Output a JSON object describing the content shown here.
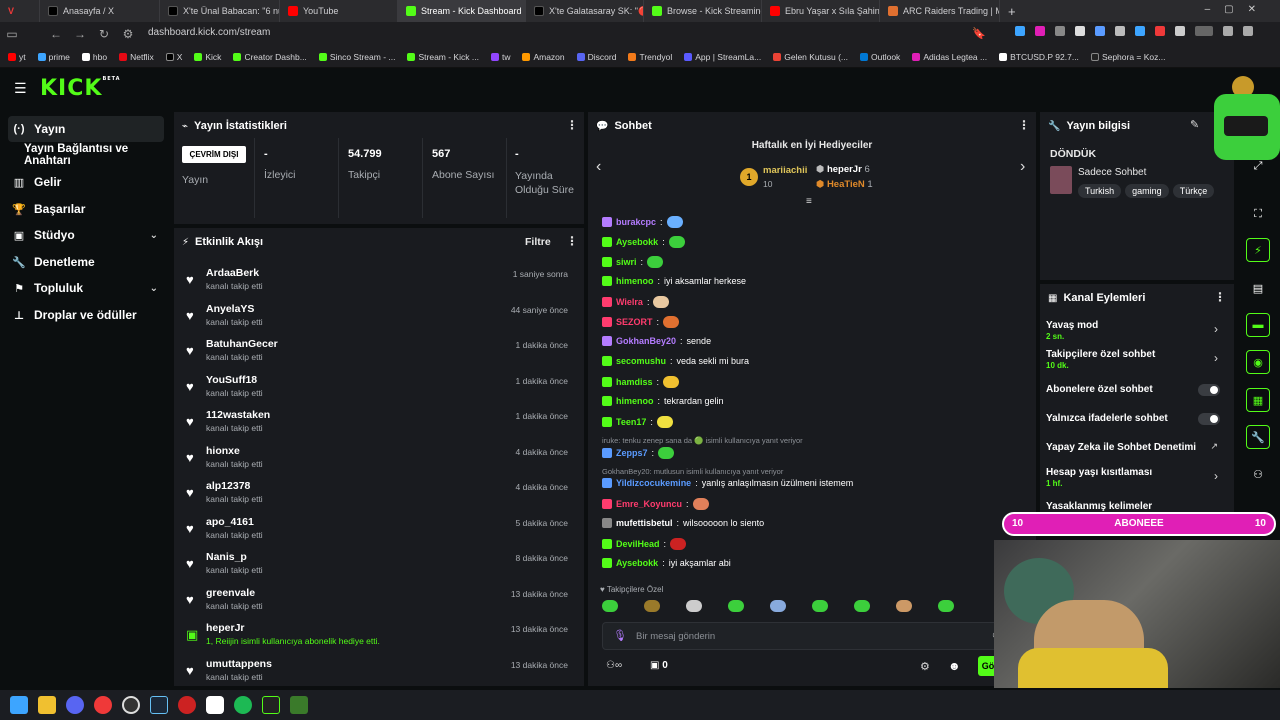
{
  "browser": {
    "tabs": [
      {
        "label": "Anasayfa / X",
        "color": "#000000"
      },
      {
        "label": "X'te Ünal Babacan: \"6 num",
        "color": "#000000"
      },
      {
        "label": "YouTube",
        "color": "#ff0000"
      },
      {
        "label": "Stream - Kick Dashboard",
        "color": "#53fc18"
      },
      {
        "label": "X'te Galatasaray SK: \"🔴 Ju",
        "color": "#000000"
      },
      {
        "label": "Browse - Kick Streaming",
        "color": "#53fc18"
      },
      {
        "label": "Ebru Yaşar x Sıla Şahin x Sa",
        "color": "#ff0000"
      },
      {
        "label": "ARC Raiders Trading | Meta",
        "color": "#e07030"
      }
    ],
    "new_tab": "+",
    "url": "dashboard.kick.com/stream",
    "bookmarks": [
      "yt",
      "prime",
      "hbo",
      "Netflix",
      "X",
      "Kick",
      "Creator Dashb...",
      "Sinco Stream - ...",
      "Stream - Kick ...",
      "tw",
      "Amazon",
      "Discord",
      "Trendyol",
      "App | StreamLa...",
      "Gelen Kutusu (...",
      "Outlook",
      "Adidas Legtea ...",
      "BTCUSD.P 92.7...",
      "Sephora = Koz..."
    ]
  },
  "header": {
    "logo": "KICK",
    "beta": "BETA"
  },
  "sidebar": {
    "items": [
      {
        "label": "Yayın",
        "icon": "broadcast-icon"
      },
      {
        "label": "Yayın Bağlantısı ve Anahtarı"
      },
      {
        "label": "Gelir",
        "icon": "chart-icon"
      },
      {
        "label": "Başarılar",
        "icon": "trophy-icon"
      },
      {
        "label": "Stüdyo",
        "icon": "studio-icon"
      },
      {
        "label": "Denetleme",
        "icon": "wrench-icon"
      },
      {
        "label": "Topluluk",
        "icon": "community-icon"
      },
      {
        "label": "Droplar ve ödüller",
        "icon": "drops-icon"
      }
    ]
  },
  "stats": {
    "title": "Yayın İstatistikleri",
    "status": "ÇEVRİM DIŞI",
    "status_label": "Yayın",
    "items": [
      {
        "value": "-",
        "label": "İzleyici"
      },
      {
        "value": "54.799",
        "label": "Takipçi"
      },
      {
        "value": "567",
        "label": "Abone Sayısı"
      },
      {
        "value": "-",
        "label": "Yayında Olduğu Süre"
      }
    ]
  },
  "activity": {
    "title": "Etkinlik Akışı",
    "filter": "Filtre",
    "rows": [
      {
        "name": "ArdaaBerk",
        "sub": "kanalı takip etti",
        "time": "1 saniye sonra"
      },
      {
        "name": "AnyelaYS",
        "sub": "kanalı takip etti",
        "time": "44 saniye önce"
      },
      {
        "name": "BatuhanGecer",
        "sub": "kanalı takip etti",
        "time": "1 dakika önce"
      },
      {
        "name": "YouSuff18",
        "sub": "kanalı takip etti",
        "time": "1 dakika önce"
      },
      {
        "name": "112wastaken",
        "sub": "kanalı takip etti",
        "time": "1 dakika önce"
      },
      {
        "name": "hionxe",
        "sub": "kanalı takip etti",
        "time": "4 dakika önce"
      },
      {
        "name": "alp12378",
        "sub": "kanalı takip etti",
        "time": "4 dakika önce"
      },
      {
        "name": "apo_4161",
        "sub": "kanalı takip etti",
        "time": "5 dakika önce"
      },
      {
        "name": "Nanis_p",
        "sub": "kanalı takip etti",
        "time": "8 dakika önce"
      },
      {
        "name": "greenvale",
        "sub": "kanalı takip etti",
        "time": "13 dakika önce"
      },
      {
        "name": "heperJr",
        "sub": "1, Reiijin isimli kullanıcıya abonelik hediye etti.",
        "time": "13 dakika önce",
        "gift": true
      },
      {
        "name": "umuttappens",
        "sub": "kanalı takip etti",
        "time": "13 dakika önce"
      }
    ]
  },
  "chat": {
    "title": "Sohbet",
    "gifters_title": "Haftalık en İyi Hediyeciler",
    "gifters": [
      {
        "rank": "1",
        "name": "mariiachii",
        "count": "10"
      },
      {
        "name": "heperJr",
        "count": "6"
      },
      {
        "name": "HeaTieN",
        "count": "1"
      }
    ],
    "messages": [
      {
        "user": "burakcpc",
        "color": "#b47cff",
        "text": ""
      },
      {
        "user": "Aysebokk",
        "color": "#53fc18",
        "text": ""
      },
      {
        "user": "siwri",
        "color": "#53fc18",
        "text": ""
      },
      {
        "user": "himenoo",
        "color": "#53fc18",
        "text": "iyi aksamlar herkese"
      },
      {
        "user": "Wielra",
        "color": "#ff3c6e",
        "text": ""
      },
      {
        "user": "SEZORT",
        "color": "#ff3c6e",
        "text": ""
      },
      {
        "user": "GokhanBey20",
        "color": "#b47cff",
        "text": "sende"
      },
      {
        "user": "secomushu",
        "color": "#53fc18",
        "text": "veda sekli mi bura"
      },
      {
        "user": "hamdiss",
        "color": "#53fc18",
        "text": ""
      },
      {
        "user": "himenoo",
        "color": "#53fc18",
        "text": "tekrardan gelin"
      },
      {
        "user": "Teen17",
        "color": "#53fc18",
        "text": ""
      },
      {
        "user": "Zepps7",
        "color": "#5a9bff",
        "text": "",
        "reply": "iruke: tenku zenep sana da 🟢 isimli kullanıcıya yanıt veriyor"
      },
      {
        "user": "Yildizcocukemine",
        "color": "#5a9bff",
        "text": "yanlış anlaşılmasın üzülmeni istemem",
        "reply": "GokhanBey20: mutlusun isimli kullanıcıya yanıt veriyor"
      },
      {
        "user": "Emre_Koyuncu",
        "color": "#ff3c6e",
        "text": ""
      },
      {
        "user": "mufettisbetul",
        "color": "#fff",
        "text": "wilsooooon lo siento"
      },
      {
        "user": "DevilHead",
        "color": "#53fc18",
        "text": ""
      },
      {
        "user": "Aysebokk",
        "color": "#53fc18",
        "text": "iyi akşamlar abi"
      }
    ],
    "followers_only": "Takipçilere Özel",
    "input_placeholder": "Bir mesaj gönderin",
    "points": "0",
    "send": "Gö"
  },
  "stream_info": {
    "title": "Yayın bilgisi",
    "stream_title": "DÖNDÜK",
    "category": "Sadece Sohbet",
    "tags": [
      "Turkish",
      "gaming",
      "Türkçe"
    ]
  },
  "channel_actions": {
    "title": "Kanal Eylemleri",
    "items": [
      {
        "label": "Yavaş mod",
        "sub": "2 sn.",
        "type": "chevron"
      },
      {
        "label": "Takipçilere özel sohbet",
        "sub": "10 dk.",
        "type": "chevron"
      },
      {
        "label": "Abonelere özel sohbet",
        "type": "toggle"
      },
      {
        "label": "Yalnızca ifadelerle sohbet",
        "type": "toggle"
      },
      {
        "label": "Yapay Zeka ile Sohbet Denetimi",
        "type": "external"
      },
      {
        "label": "Hesap yaşı kısıtlaması",
        "sub": "1 hf.",
        "type": "chevron"
      },
      {
        "label": "Yasaklanmış kelimeler",
        "type": "chevron"
      }
    ]
  },
  "sub_banner": {
    "left": "10",
    "label": "ABONEEE",
    "right": "10"
  },
  "colors": {
    "brand": "#53fc18",
    "banner": "#e01fb6",
    "panel": "#191b1f"
  }
}
